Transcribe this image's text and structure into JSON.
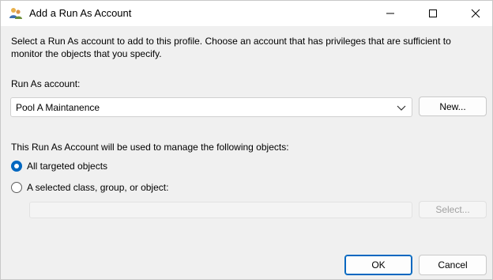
{
  "window": {
    "title": "Add a Run As Account",
    "icons": {
      "app": "account-people-icon",
      "minimize": "minimize-icon",
      "maximize": "maximize-icon",
      "close": "close-icon"
    }
  },
  "description": "Select a Run As account to add to this profile.  Choose an account that has privileges that are sufficient to monitor the objects that you specify.",
  "run_as": {
    "label": "Run As account:",
    "selected": "Pool A Maintanence",
    "new_button": "New..."
  },
  "objects": {
    "label": "This Run As Account will be used to manage the following objects:",
    "option_all": "All targeted objects",
    "option_selected": "A selected class, group, or object:",
    "selected_option": "All targeted objects",
    "select_button": "Select..."
  },
  "footer": {
    "ok_button": "OK",
    "cancel_button": "Cancel"
  },
  "colors": {
    "accent": "#0067c0",
    "background": "#f0f0f0",
    "titlebar": "#ffffff"
  }
}
